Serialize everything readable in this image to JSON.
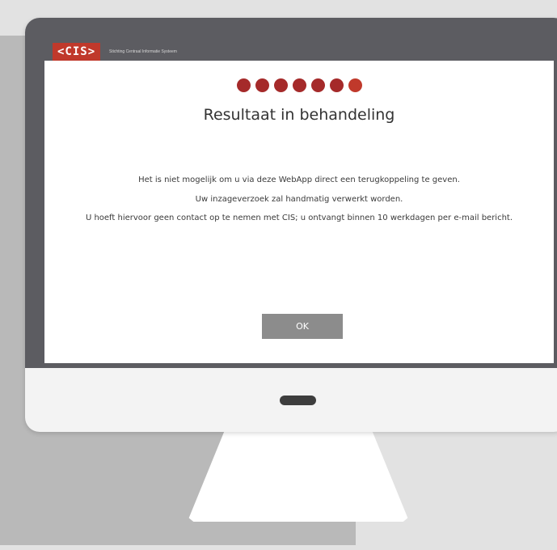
{
  "app": {
    "logo_text": "<CIS>",
    "logo_subtitle": "Stichting Centraal Informatie Systeem"
  },
  "progress": {
    "dots": 7,
    "color": "#a52a2a"
  },
  "dialog": {
    "title": "Resultaat in behandeling",
    "lines": [
      "Het is niet mogelijk om u via deze WebApp direct een terugkoppeling te geven.",
      "Uw inzageverzoek zal handmatig verwerkt worden.",
      "U hoeft hiervoor geen contact op te nemen met CIS; u ontvangt binnen 10 werkdagen per e-mail bericht."
    ],
    "ok_label": "OK"
  }
}
